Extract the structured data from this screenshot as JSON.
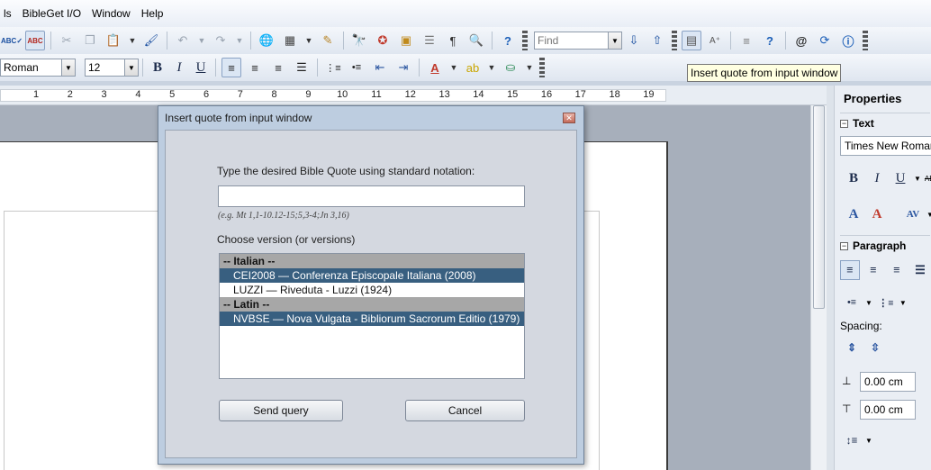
{
  "menu": {
    "items": [
      "ls",
      "BibleGet I/O",
      "Window",
      "Help"
    ]
  },
  "toolbar": {
    "find_placeholder": "Find",
    "font_name": "Roman",
    "font_size": "12",
    "tooltip": "Insert quote from input window"
  },
  "ruler": {
    "ticks": [
      "1",
      "2",
      "3",
      "4",
      "5",
      "6",
      "7",
      "8",
      "9",
      "10",
      "11",
      "12",
      "13",
      "14",
      "15",
      "16",
      "17",
      "18",
      "19"
    ]
  },
  "sidebar": {
    "title": "Properties",
    "text_section": "Text",
    "font_value": "Times New Roman",
    "paragraph_section": "Paragraph",
    "spacing_label": "Spacing:",
    "spacing_above": "0.00 cm",
    "spacing_below": "0.00 cm"
  },
  "dialog": {
    "title": "Insert quote from input window",
    "instruction": "Type the desired Bible Quote using standard notation:",
    "input_value": "",
    "example": "(e.g. Mt 1,1-10.12-15;5,3-4;Jn 3,16)",
    "versions_label": "Choose version (or versions)",
    "versions": [
      {
        "kind": "group",
        "text": "-- Italian --"
      },
      {
        "kind": "selected",
        "text": "CEI2008 — Conferenza Episcopale Italiana (2008)"
      },
      {
        "kind": "item",
        "text": "LUZZI — Riveduta - Luzzi (1924)"
      },
      {
        "kind": "group",
        "text": "-- Latin --"
      },
      {
        "kind": "selected",
        "text": "NVBSE — Nova Vulgata - Bibliorum Sacrorum Editio (1979)"
      }
    ],
    "send_label": "Send query",
    "cancel_label": "Cancel"
  },
  "colors": {
    "selection": "#385f80",
    "group_header": "#a7a7a7",
    "tooltip_bg": "#ffffe1"
  }
}
